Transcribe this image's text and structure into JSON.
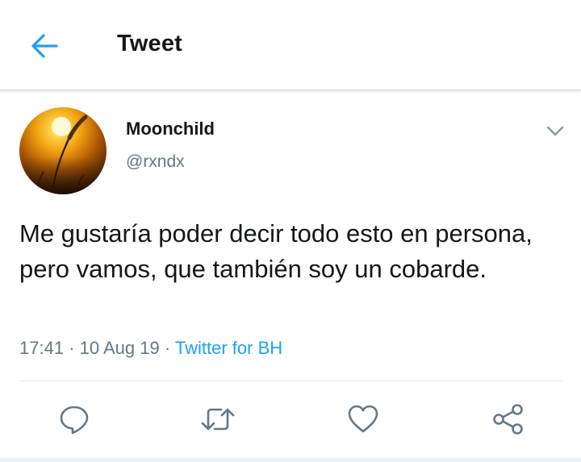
{
  "header": {
    "title": "Tweet",
    "back_icon": "arrow-left-icon"
  },
  "tweet": {
    "display_name": "Moonchild",
    "handle": "@rxndx",
    "text": "Me gustaría poder decir todo esto en persona, pero vamos, que también soy un cobarde.",
    "time": "17:41",
    "separator_1": " · ",
    "date": "10 Aug 19",
    "separator_2": " · ",
    "source": "Twitter for BH"
  },
  "actions": [
    {
      "name": "reply",
      "icon": "reply-icon"
    },
    {
      "name": "retweet",
      "icon": "retweet-icon"
    },
    {
      "name": "like",
      "icon": "heart-icon"
    },
    {
      "name": "share",
      "icon": "share-icon"
    }
  ],
  "colors": {
    "accent": "#1da1f2",
    "text_primary": "#14171a",
    "text_secondary": "#657786",
    "icon_gray": "#657786",
    "divider": "#e1e8ed"
  }
}
